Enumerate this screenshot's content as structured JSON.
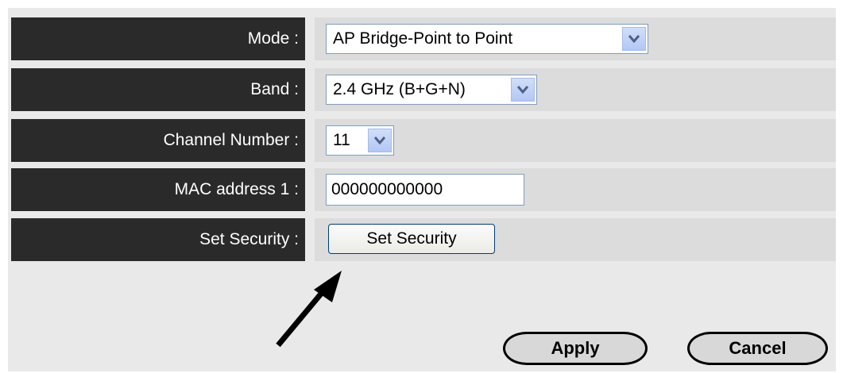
{
  "form": {
    "mode": {
      "label": "Mode :",
      "value": "AP Bridge-Point to Point"
    },
    "band": {
      "label": "Band :",
      "value": "2.4 GHz (B+G+N)"
    },
    "channel": {
      "label": "Channel Number :",
      "value": "11"
    },
    "mac1": {
      "label": "MAC address 1 :",
      "value": "000000000000"
    },
    "security": {
      "label": "Set Security :",
      "button": "Set Security"
    }
  },
  "actions": {
    "apply": "Apply",
    "cancel": "Cancel"
  },
  "colors": {
    "label_bg": "#2a2a2a",
    "value_bg": "#dcdcdc",
    "panel_bg": "#e9e9e9",
    "dropdown_accent": "#b3c7f5"
  },
  "icons": {
    "dropdown": "chevron-down-icon",
    "pointer": "arrow-icon"
  }
}
